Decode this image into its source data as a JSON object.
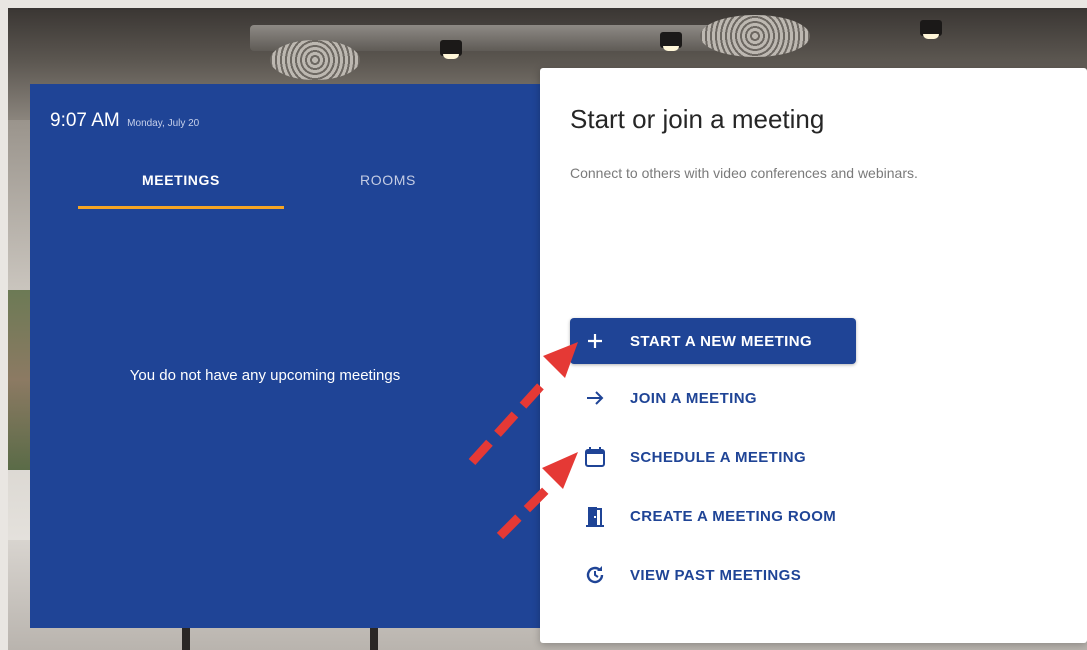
{
  "left_panel": {
    "time": "9:07 AM",
    "date": "Monday, July 20",
    "tabs": [
      {
        "label": "MEETINGS",
        "active": true
      },
      {
        "label": "ROOMS",
        "active": false
      }
    ],
    "empty_message": "You do not have any upcoming meetings"
  },
  "right_card": {
    "title": "Start or join a meeting",
    "subtitle": "Connect to others with video conferences and webinars.",
    "actions": [
      {
        "label": "START A NEW MEETING",
        "icon": "plus-icon",
        "primary": true
      },
      {
        "label": "JOIN A MEETING",
        "icon": "arrow-right-icon",
        "primary": false
      },
      {
        "label": "SCHEDULE A MEETING",
        "icon": "calendar-icon",
        "primary": false
      },
      {
        "label": "CREATE A MEETING ROOM",
        "icon": "door-icon",
        "primary": false
      },
      {
        "label": "VIEW PAST MEETINGS",
        "icon": "history-icon",
        "primary": false
      }
    ]
  },
  "colors": {
    "brand_blue": "#1f4496",
    "tab_underline": "#f5a524",
    "annotation_arrow": "#e53935"
  }
}
